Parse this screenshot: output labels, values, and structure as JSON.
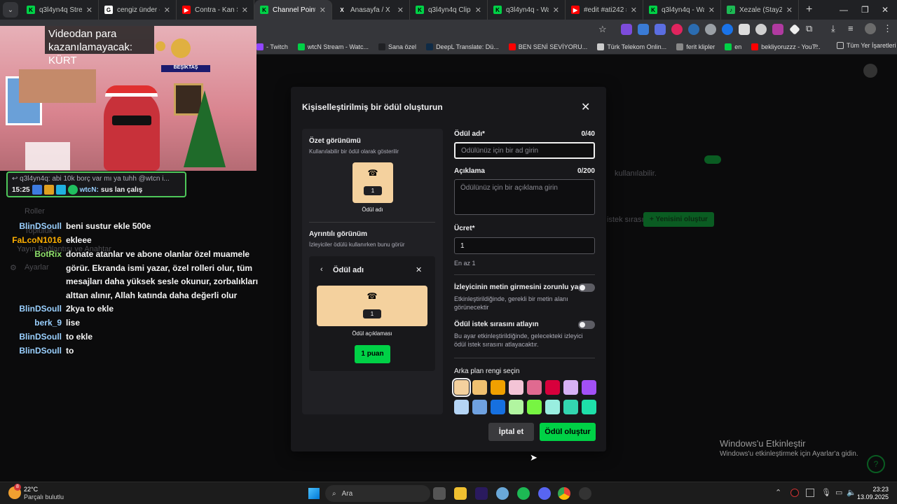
{
  "tabs": [
    {
      "title": "q3l4yn4q Stream",
      "fav_color": "#00d146",
      "fav_glyph": "K"
    },
    {
      "title": "cengiz ünder - Go",
      "fav_color": "#ffffff",
      "fav_glyph": "G"
    },
    {
      "title": "Contra - Kan Sahi",
      "fav_color": "#ff0000",
      "fav_glyph": "▶"
    },
    {
      "title": "Channel Points - K",
      "fav_color": "#00d146",
      "fav_glyph": "K",
      "active": true
    },
    {
      "title": "Anasayfa / X",
      "fav_color": "#202124",
      "fav_glyph": "X"
    },
    {
      "title": "q3l4yn4q Clips - K",
      "fav_color": "#00d146",
      "fav_glyph": "K"
    },
    {
      "title": "q3l4yn4q - Watch",
      "fav_color": "#00d146",
      "fav_glyph": "K"
    },
    {
      "title": "#edit #ati242 #ç",
      "fav_color": "#ff0000",
      "fav_glyph": "▶"
    },
    {
      "title": "q3l4yn4q - Watch",
      "fav_color": "#00d146",
      "fav_glyph": "K"
    },
    {
      "title": "Xezale (StayZee R",
      "fav_color": "#1db954",
      "fav_glyph": "♪"
    }
  ],
  "bookmarks": [
    {
      "label": "- Twitch",
      "color": "#9146ff"
    },
    {
      "label": "wtcN Stream - Watc...",
      "color": "#00d146"
    },
    {
      "label": "Sana özel",
      "color": "#202124"
    },
    {
      "label": "DeepL Translate: Dü...",
      "color": "#0f2b46"
    },
    {
      "label": "BEN SENİ SEVİYORU...",
      "color": "#ff0000"
    },
    {
      "label": "Türk Telekom Onlin...",
      "color": "#cccccc"
    },
    {
      "label": "ferit klipler",
      "color": "#888888"
    },
    {
      "label": "en",
      "color": "#00d146"
    },
    {
      "label": "bekliyoruzzz - YouT...",
      "color": "#ff0000"
    }
  ],
  "all_bookmarks": "Tüm Yer İşaretleri",
  "video": {
    "caption": "Videodan para kazanılamayacak: KÜRT",
    "banner": "BEŞİKTAŞ"
  },
  "popup": {
    "reply": "q3l4yn4q: abi 10k borç var mı ya tuhh @wtcn i...",
    "time": "15:25",
    "user": "wtcN:",
    "message": "sus lan çalış"
  },
  "background": {
    "roller": "Roller",
    "topluluk": "Topluluk",
    "yayin": "Yayın Bağlantısı ve Anahtar",
    "ayarlar": "Ayarlar",
    "istek": "istek sırası",
    "yeni": "Yenisini oluştur",
    "available": "kullanılabilir."
  },
  "chat": [
    {
      "user": "BlinDSoull",
      "color": "#9ad0ff",
      "msg": "beni sustur ekle 500e"
    },
    {
      "user": "FaLcoN1016",
      "color": "#ffb000",
      "msg": "ekleee"
    },
    {
      "user": "BotRix",
      "color": "#8ee06a",
      "msg": "donate atanlar ve abone olanlar özel muamele görür. Ekranda ismi yazar, özel rolleri olur, tüm mesajları daha yüksek sesle okunur, zorbalıkları alttan alınır, Allah katında daha değerli olur"
    },
    {
      "user": "BlinDSoull",
      "color": "#9ad0ff",
      "msg": "2kya to ekle"
    },
    {
      "user": "berk_9",
      "color": "#9ad0ff",
      "msg": "lise"
    },
    {
      "user": "BlinDSoull",
      "color": "#9ad0ff",
      "msg": "to ekle"
    },
    {
      "user": "BlinDSoull",
      "color": "#9ad0ff",
      "msg": "to"
    }
  ],
  "modal": {
    "title": "Kişiselleştirilmiş bir ödül oluşturun",
    "summary_title": "Özet görünümü",
    "summary_sub": "Kullanılabilir bir ödül olarak gösterilir",
    "tile_cost": "1",
    "reward_name": "Ödül adı",
    "detail_title": "Ayrıntılı görünüm",
    "detail_sub": "İzleyiciler ödülü kullanırken bunu görür",
    "detail_card_title": "Ödül adı",
    "detail_desc": "Ödül açıklaması",
    "points_button": "1 puan",
    "name_label": "Ödül adı*",
    "name_count": "0/40",
    "name_placeholder": "Ödülünüz için bir ad girin",
    "desc_label": "Açıklama",
    "desc_count": "0/200",
    "desc_placeholder": "Ödülünüz için bir açıklama girin",
    "cost_label": "Ücret*",
    "cost_value": "1",
    "cost_help": "En az 1",
    "require_text_label": "İzleyicinin metin girmesini zorunlu yap",
    "require_text_help": "Etkinleştirildiğinde, gerekli bir metin alanı görünecektir",
    "skip_queue_label": "Ödül istek sırasını atlayın",
    "skip_queue_help": "Bu ayar etkinleştirildiğinde, gelecekteki izleyici ödül istek sırasını atlayacaktır.",
    "bg_color_label": "Arka plan rengi seçin",
    "swatches": [
      "#f4d19e",
      "#f0c070",
      "#f0a000",
      "#f3c4d6",
      "#e06a90",
      "#d8003c",
      "#d6b1f5",
      "#a250f5",
      "#b4d4f5",
      "#6fa1e0",
      "#1670e0",
      "#b1f5a0",
      "#77f542",
      "#99eee0",
      "#33d6b0",
      "#1ee0a9"
    ],
    "cancel": "İptal et",
    "create": "Ödül oluştur"
  },
  "watermark": {
    "line1": "Windows'u Etkinleştir",
    "line2": "Windows'u etkinleştirmek için Ayarlar'a gidin."
  },
  "taskbar": {
    "temp": "22°C",
    "weather": "Parçalı bulutlu",
    "search": "Ara",
    "time": "23:23",
    "date": "13.09.2025",
    "weather_badge": "8"
  }
}
